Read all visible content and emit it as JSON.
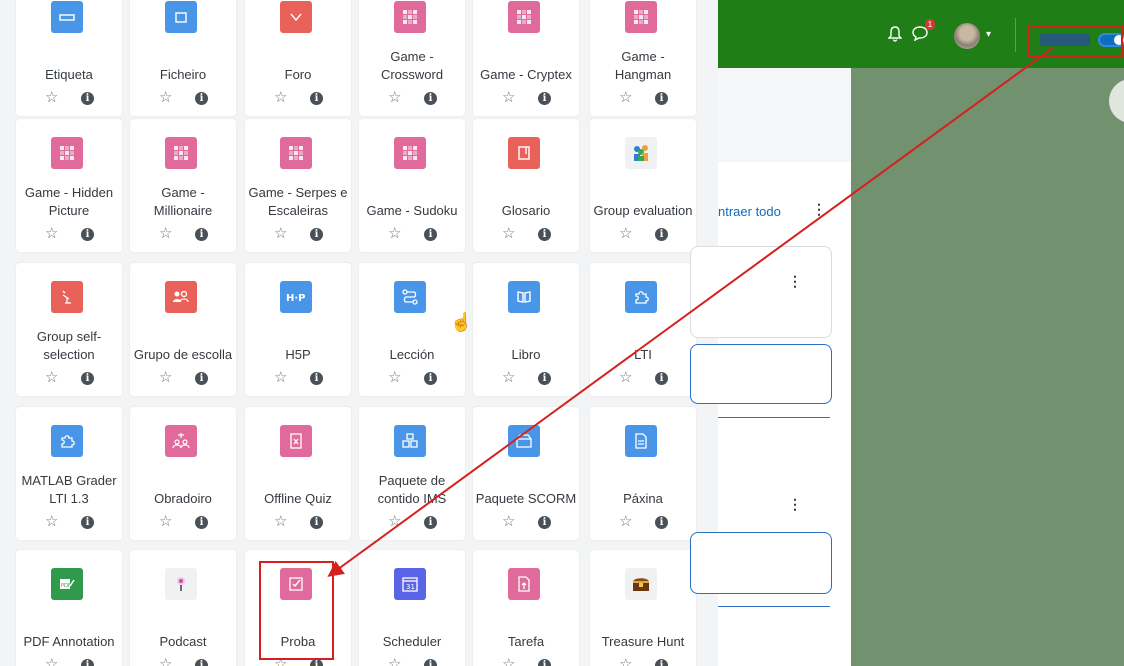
{
  "colors": {
    "communication": "#e36397",
    "content": "#4996e9",
    "collaboration": "#e9625a",
    "assessment": "#e06a9c",
    "interactive": "#5a64e7",
    "navy": "#1f7e15",
    "green_bg": "#72916e",
    "annotation_red": "#d61f1f"
  },
  "modules": [
    {
      "name": "Etiqueta",
      "icon": "label-icon",
      "color": "#4996e9"
    },
    {
      "name": "Ficheiro",
      "icon": "file-icon",
      "color": "#4996e9"
    },
    {
      "name": "Foro",
      "icon": "forum-icon",
      "color": "#e9625a"
    },
    {
      "name": "Game - Crossword",
      "icon": "game-icon",
      "color": "#e06a9c"
    },
    {
      "name": "Game - Cryptex",
      "icon": "game-icon",
      "color": "#e06a9c"
    },
    {
      "name": "Game - Hangman",
      "icon": "game-icon",
      "color": "#e06a9c"
    },
    {
      "name": "Game - Hidden Picture",
      "icon": "game-icon",
      "color": "#e06a9c"
    },
    {
      "name": "Game - Millionaire",
      "icon": "game-icon",
      "color": "#e06a9c"
    },
    {
      "name": "Game - Serpes e Escaleiras",
      "icon": "game-icon",
      "color": "#e06a9c"
    },
    {
      "name": "Game - Sudoku",
      "icon": "game-icon",
      "color": "#e06a9c"
    },
    {
      "name": "Glosario",
      "icon": "glossary-icon",
      "color": "#e9625a"
    },
    {
      "name": "Group evaluation",
      "icon": "group-evaluation-icon",
      "color": "#f0f1f3"
    },
    {
      "name": "Group self-selection",
      "icon": "group-self-selection-icon",
      "color": "#e9625a"
    },
    {
      "name": "Grupo de escolla",
      "icon": "choice-group-icon",
      "color": "#e9625a"
    },
    {
      "name": "H5P",
      "icon": "h5p-icon",
      "color": "#4996e9"
    },
    {
      "name": "Lección",
      "icon": "lesson-icon",
      "color": "#4996e9"
    },
    {
      "name": "Libro",
      "icon": "book-icon",
      "color": "#4996e9"
    },
    {
      "name": "LTI",
      "icon": "puzzle-icon",
      "color": "#4996e9"
    },
    {
      "name": "MATLAB Grader LTI 1.3",
      "icon": "puzzle-icon",
      "color": "#4996e9"
    },
    {
      "name": "Obradoiro",
      "icon": "workshop-icon",
      "color": "#e06a9c"
    },
    {
      "name": "Offline Quiz",
      "icon": "offline-quiz-icon",
      "color": "#e06a9c"
    },
    {
      "name": "Paquete de contido IMS",
      "icon": "ims-package-icon",
      "color": "#4996e9"
    },
    {
      "name": "Paquete SCORM",
      "icon": "scorm-package-icon",
      "color": "#4996e9"
    },
    {
      "name": "Páxina",
      "icon": "page-icon",
      "color": "#4996e9"
    },
    {
      "name": "PDF Annotation",
      "icon": "pdf-annotation-icon",
      "color": "#2f9a4c"
    },
    {
      "name": "Podcast",
      "icon": "podcast-icon",
      "color": "#f0f1f3"
    },
    {
      "name": "Proba",
      "icon": "quiz-icon",
      "color": "#e06a9c"
    },
    {
      "name": "Scheduler",
      "icon": "scheduler-icon",
      "color": "#5a64e7"
    },
    {
      "name": "Tarefa",
      "icon": "assignment-icon",
      "color": "#e06a9c"
    },
    {
      "name": "Treasure Hunt",
      "icon": "treasure-chest-icon",
      "color": "#f0f1f3"
    }
  ],
  "page": {
    "collapse_all": "ntraer todo",
    "notification_count": "1"
  }
}
